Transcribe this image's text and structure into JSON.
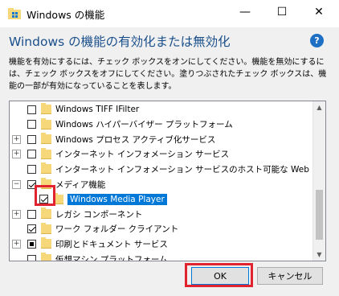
{
  "window": {
    "title": "Windows の機能",
    "minimize": "—",
    "maximize": "☐",
    "close": "✕"
  },
  "header": {
    "heading": "Windows の機能の有効化または無効化",
    "help": "?"
  },
  "description": "機能を有効にするには、チェック ボックスをオンにしてください。機能を無効にするには、チェック ボックスをオフにしてください。塗りつぶされたチェック ボックスは、機能の一部が有効になっていることを表します。",
  "features": [
    {
      "label": "Windows TIFF IFilter",
      "state": "unchecked",
      "expandable": false,
      "indent": 0
    },
    {
      "label": "Windows ハイパーバイザー プラットフォーム",
      "state": "unchecked",
      "expandable": false,
      "indent": 0
    },
    {
      "label": "Windows プロセス アクティブ化サービス",
      "state": "unchecked",
      "expandable": true,
      "indent": 0
    },
    {
      "label": "インターネット インフォメーション サービス",
      "state": "unchecked",
      "expandable": true,
      "indent": 0
    },
    {
      "label": "インターネット インフォメーション サービスのホスト可能な Web コア",
      "state": "unchecked",
      "expandable": false,
      "indent": 0
    },
    {
      "label": "メディア機能",
      "state": "checked",
      "expandable": true,
      "expanded": true,
      "indent": 0
    },
    {
      "label": "Windows Media Player",
      "state": "checked",
      "expandable": false,
      "indent": 1,
      "selected": true
    },
    {
      "label": "レガシ コンポーネント",
      "state": "unchecked",
      "expandable": true,
      "indent": 0
    },
    {
      "label": "ワーク フォルダー クライアント",
      "state": "checked",
      "expandable": false,
      "indent": 0
    },
    {
      "label": "印刷とドキュメント サービス",
      "state": "partial",
      "expandable": true,
      "indent": 0
    },
    {
      "label": "仮想マシン プラットフォーム",
      "state": "unchecked",
      "expandable": false,
      "indent": 0
    }
  ],
  "buttons": {
    "ok": "OK",
    "cancel": "キャンセル"
  },
  "colors": {
    "accent": "#0078d7",
    "heading": "#1a4f8c",
    "highlight_box": "#e0232e",
    "folder": "#f6d77a"
  }
}
